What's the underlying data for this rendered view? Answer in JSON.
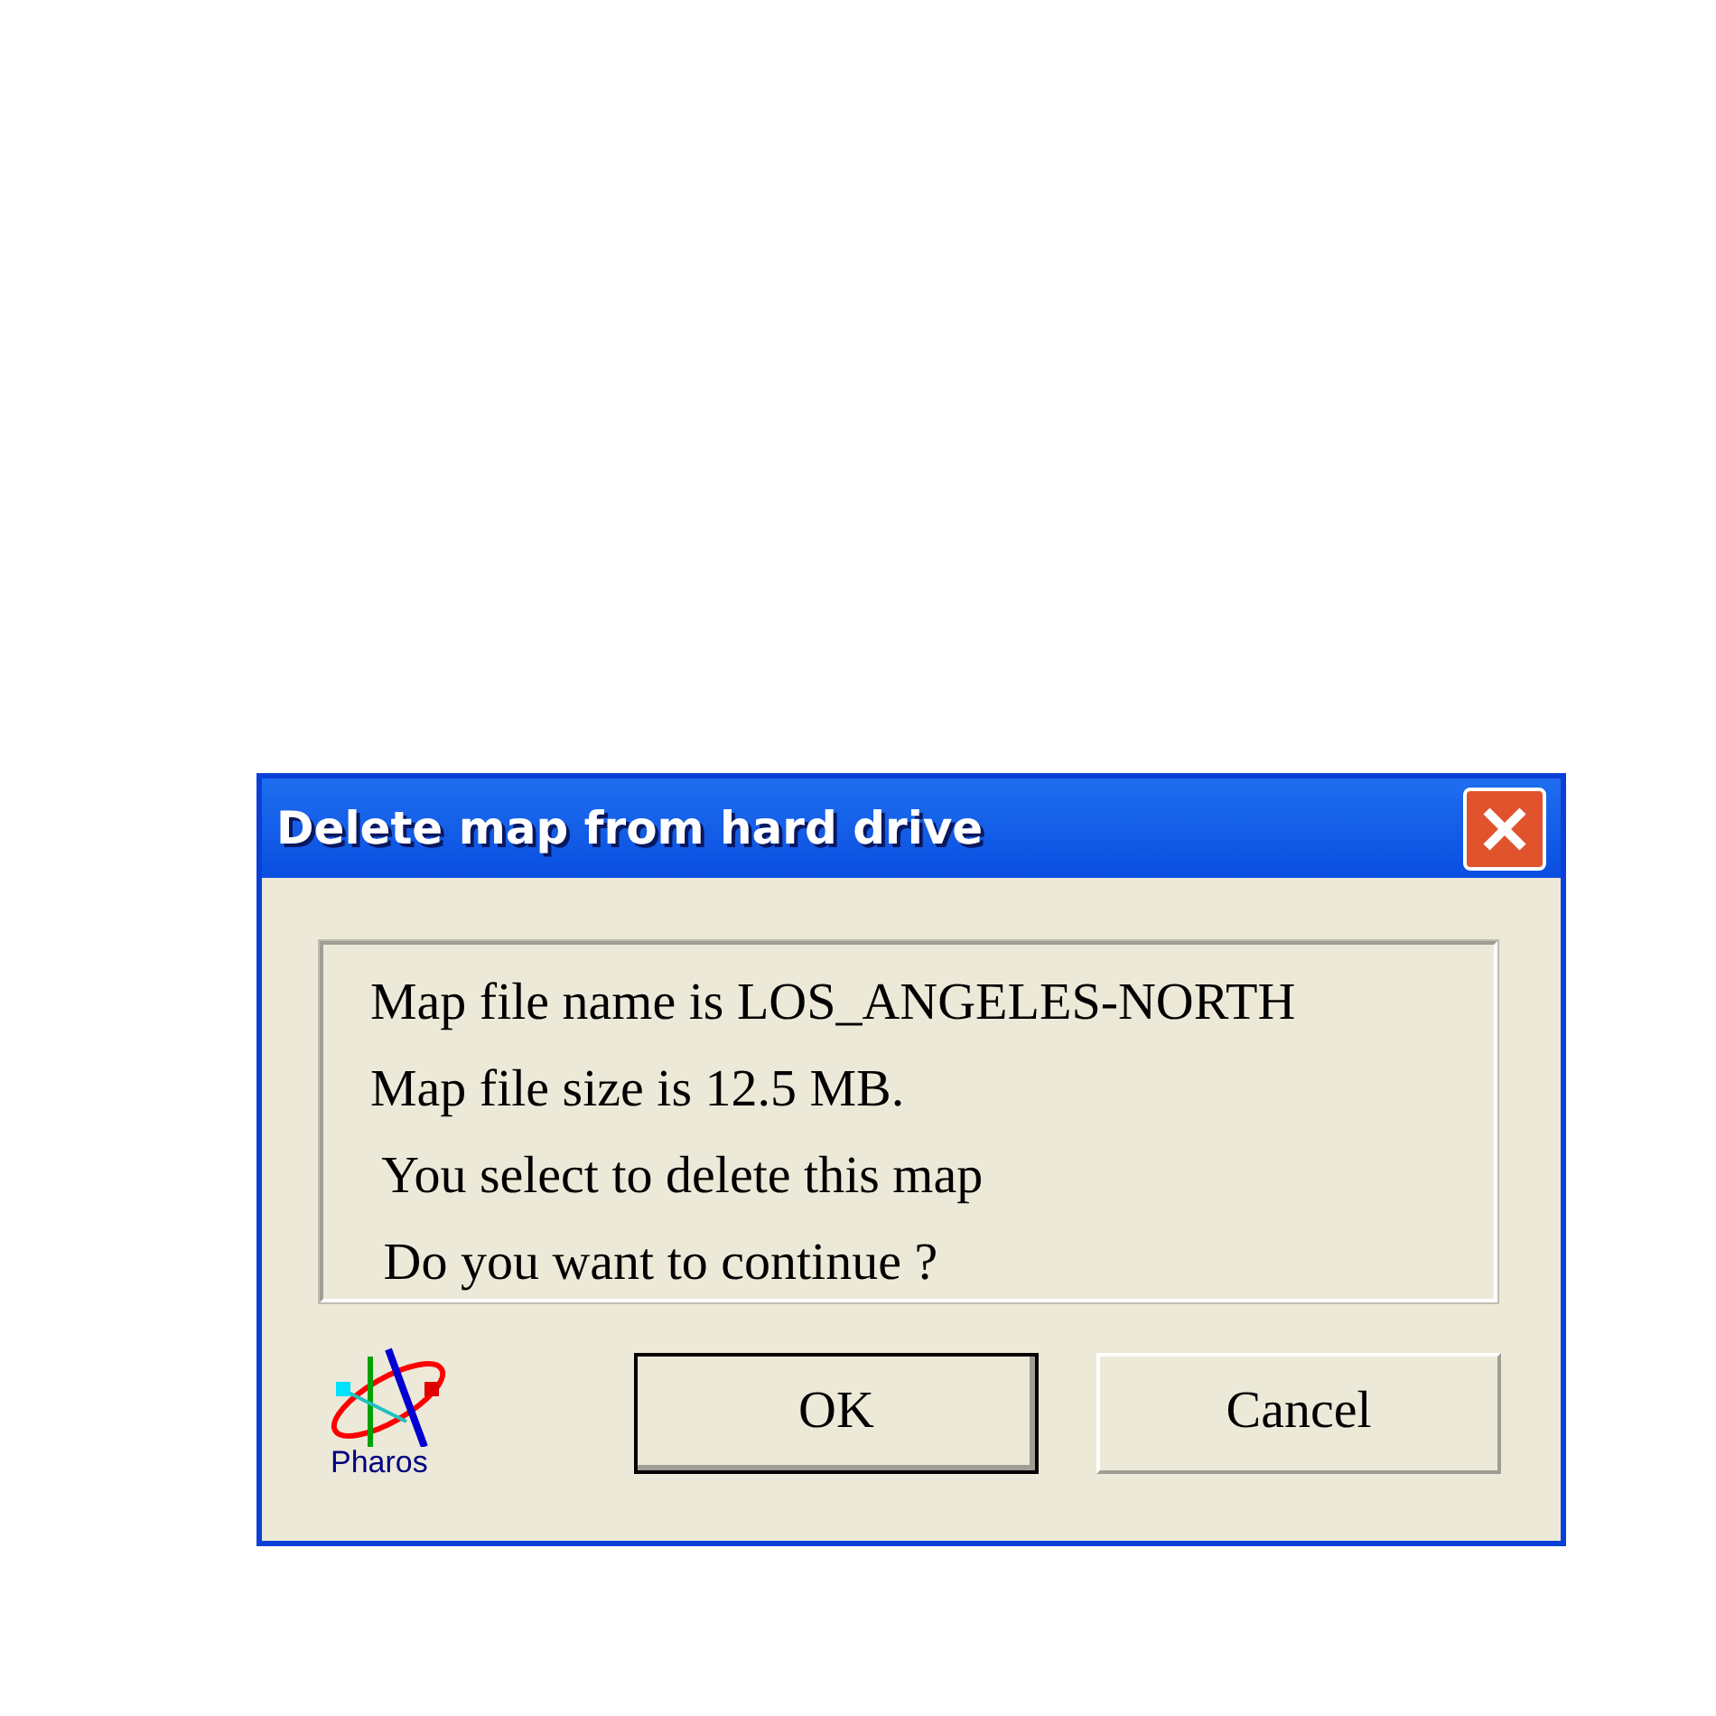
{
  "window": {
    "title": "Delete map from hard drive"
  },
  "message_lines": [
    "Map file name is LOS_ANGELES-NORTH",
    "Map file size is 12.5 MB.",
    " You select to delete this map",
    " Do you want to continue ?"
  ],
  "logo": {
    "label": "Pharos"
  },
  "buttons": [
    {
      "label": "OK",
      "default": true
    },
    {
      "label": "Cancel",
      "default": false
    }
  ]
}
